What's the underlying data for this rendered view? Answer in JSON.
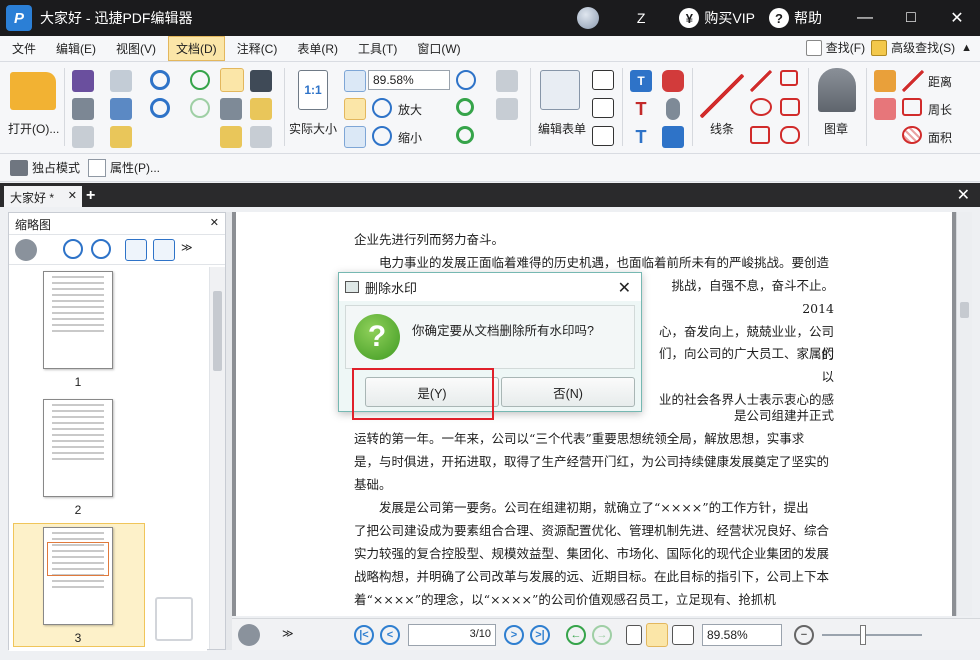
{
  "titlebar": {
    "app_title": "大家好 - 迅捷PDF编辑器",
    "user": "Z",
    "vip": "购买VIP",
    "vip_icon": "¥",
    "help": "帮助",
    "help_icon": "?"
  },
  "menu": {
    "items": [
      "文件",
      "编辑(E)",
      "视图(V)",
      "文档(D)",
      "注释(C)",
      "表单(R)",
      "工具(T)",
      "窗口(W)"
    ],
    "active": "文档(D)",
    "find": "查找(F)",
    "adv_find": "高级查找(S)"
  },
  "ribbon": {
    "open": "打开(O)...",
    "actual_size": "实际大小",
    "zoom_value": "89.58%",
    "zoom_in": "放大",
    "zoom_out": "缩小",
    "edit_form": "编辑表单",
    "line": "线条",
    "stamp": "图章",
    "distance": "距离",
    "perimeter": "周长",
    "area": "面积"
  },
  "subbar": {
    "exclusive_mode": "独占模式",
    "properties": "属性(P)..."
  },
  "tabs": {
    "doc_tab": "大家好 *"
  },
  "thumb_panel": {
    "title": "缩略图",
    "pages": [
      "1",
      "2",
      "3"
    ],
    "selected": "3"
  },
  "document": {
    "paragraphs": [
      "企业先进行列而努力奋斗。",
      "电力事业的发展正面临着难得的历史机遇，也面临着前所未有的严峻挑战。要创造",
      "挑战，自强不息，奋斗不止。2014",
      "心，奋发向上，兢兢业业，公司的",
      "们，向公司的广大员工、家属们以",
      "业的社会各界人士表示衷心的感",
      "运转的第一年。一年来，公司以“三个代表”重要思想统领全局，解放思想，实事求",
      "是，与时俱进，开拓进取，取得了生产经营开门红，为公司持续健康发展奠定了坚实的",
      "基础。",
      "发展是公司第一要务。公司在组建初期，就确立了“××××”的工作方针，提出",
      "了把公司建设成为要素组合合理、资源配置优化、管理机制先进、经营状况良好、综合",
      "实力较强的复合控股型、规模效益型、集团化、市场化、国际化的现代企业集团的发展",
      "战略构想，并明确了公司改革与发展的远、近期目标。在此目标的指引下，公司上下本",
      "着“××××”的理念，以“××××”的公司价值观感召员工，立足现有、抢抓机"
    ],
    "partial_year_line": "是公司组建并正式"
  },
  "status": {
    "page_value": "3",
    "page_total": "/10",
    "zoom": "89.58%"
  },
  "dialog": {
    "title": "删除水印",
    "message": "你确定要从文档删除所有水印吗?",
    "yes": "是(Y)",
    "no": "否(N)"
  }
}
